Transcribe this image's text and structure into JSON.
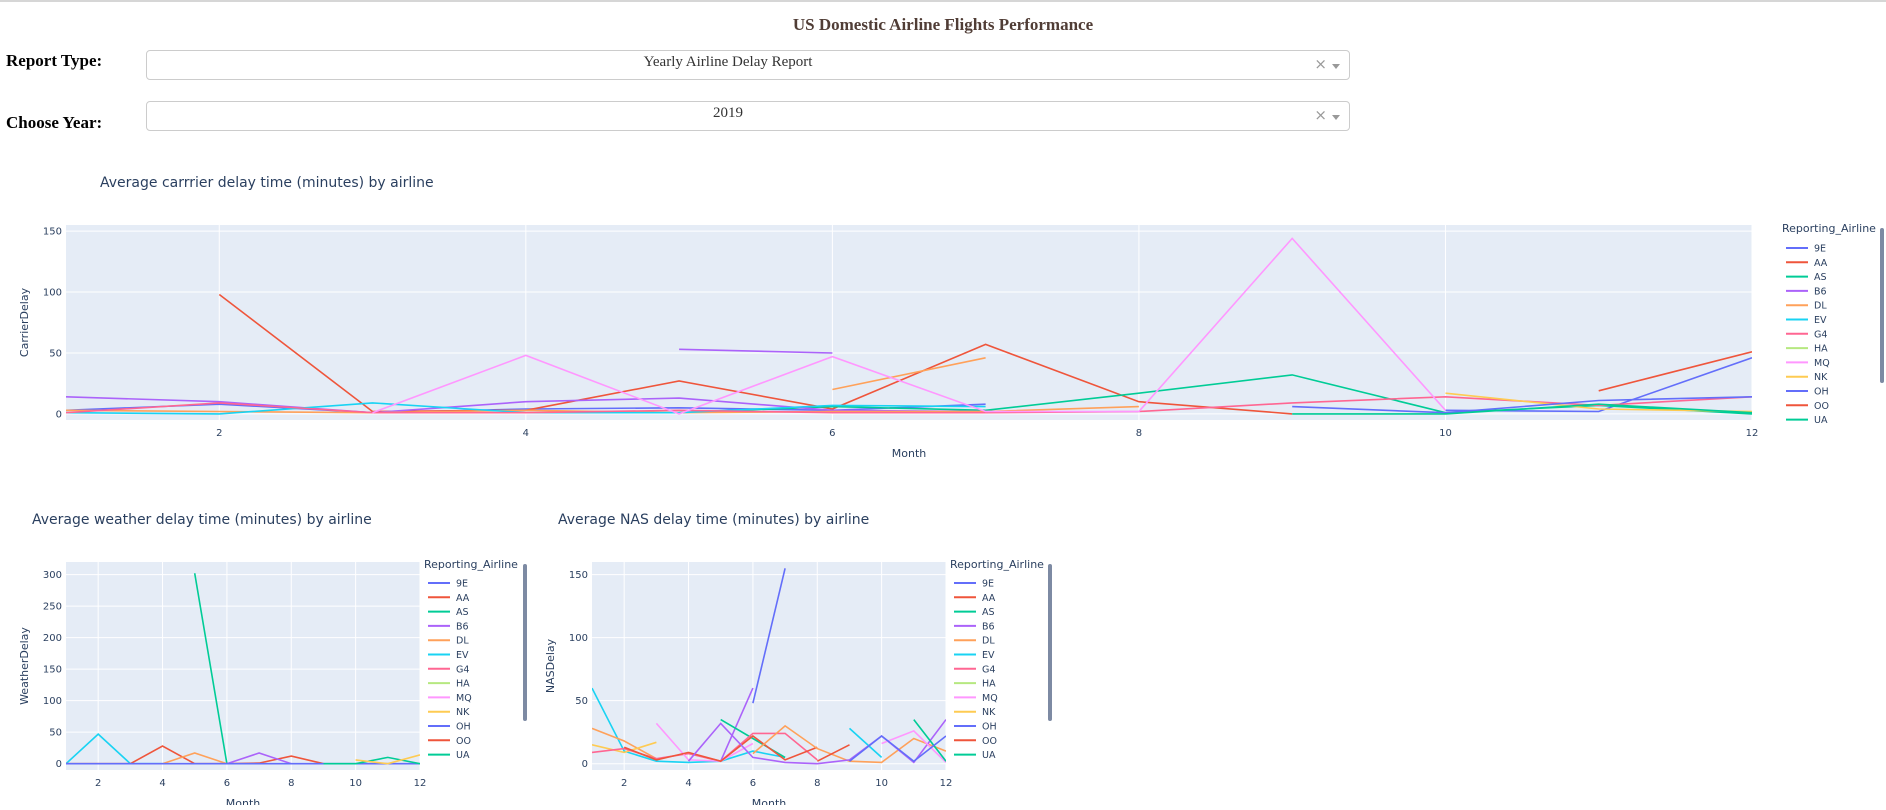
{
  "app_title": "US Domestic Airline Flights Performance",
  "controls": {
    "report_type_label": "Report Type:",
    "report_type_value": "Yearly Airline Delay Report",
    "year_label": "Choose Year:",
    "year_value": "2019",
    "clear_glyph": "×"
  },
  "legend_title": "Reporting_Airline",
  "airlines": [
    {
      "name": "9E",
      "color": "#636efa"
    },
    {
      "name": "AA",
      "color": "#EF553B"
    },
    {
      "name": "AS",
      "color": "#00cc96"
    },
    {
      "name": "B6",
      "color": "#ab63fa"
    },
    {
      "name": "DL",
      "color": "#FFA15A"
    },
    {
      "name": "EV",
      "color": "#19d3f3"
    },
    {
      "name": "G4",
      "color": "#FF6692"
    },
    {
      "name": "HA",
      "color": "#B6E880"
    },
    {
      "name": "MQ",
      "color": "#FF97FF"
    },
    {
      "name": "NK",
      "color": "#FECB52"
    },
    {
      "name": "OH",
      "color": "#636efa"
    },
    {
      "name": "OO",
      "color": "#EF553B"
    },
    {
      "name": "UA",
      "color": "#00cc96"
    }
  ],
  "chart_data": [
    {
      "id": "carrier",
      "type": "line",
      "title": "Average carrrier delay time (minutes) by airline",
      "xlabel": "Month",
      "ylabel": "CarrierDelay",
      "xlim": [
        1,
        12
      ],
      "ylim": [
        -5,
        155
      ],
      "xticks": [
        2,
        4,
        6,
        8,
        10,
        12
      ],
      "yticks": [
        0,
        50,
        100,
        150
      ],
      "grid": true,
      "legend": "right",
      "series": [
        {
          "name": "9E",
          "x": [
            1,
            2,
            3,
            4,
            5,
            6,
            7,
            8,
            9,
            10,
            11,
            12
          ],
          "y": [
            3,
            8,
            1,
            4,
            5,
            3,
            8,
            null,
            null,
            3,
            2,
            46
          ]
        },
        {
          "name": "AA",
          "x": [
            2,
            3,
            4,
            5,
            6,
            7,
            8,
            9
          ],
          "y": [
            98,
            2,
            3,
            27,
            4,
            57,
            10,
            0
          ]
        },
        {
          "name": "AS",
          "x": [
            5,
            6,
            7,
            8,
            9,
            10,
            11,
            12
          ],
          "y": [
            1,
            6,
            3,
            17,
            32,
            1,
            7,
            0
          ]
        },
        {
          "name": "B6",
          "x": [
            1,
            2,
            3,
            4,
            5,
            6,
            7
          ],
          "y": [
            14,
            10,
            1,
            10,
            13,
            3,
            2
          ]
        },
        {
          "name": "B6",
          "x": [
            5,
            6
          ],
          "y": [
            53,
            50
          ]
        },
        {
          "name": "DL",
          "x": [
            6,
            7
          ],
          "y": [
            20,
            46
          ]
        },
        {
          "name": "DL",
          "x": [
            1,
            2,
            3,
            4,
            5,
            6,
            7,
            8
          ],
          "y": [
            3,
            2,
            1,
            3,
            1,
            2,
            2,
            6
          ]
        },
        {
          "name": "EV",
          "x": [
            1,
            2,
            3,
            4,
            5,
            6,
            7
          ],
          "y": [
            1,
            0,
            9,
            1,
            1,
            7,
            6
          ]
        },
        {
          "name": "G4",
          "x": [
            1,
            2,
            3,
            4,
            5,
            6,
            7,
            8,
            9,
            10,
            11,
            12
          ],
          "y": [
            1,
            9,
            1,
            1,
            3,
            1,
            1,
            2,
            9,
            14,
            7,
            14
          ]
        },
        {
          "name": "MQ",
          "x": [
            3,
            4,
            5,
            6,
            7,
            8,
            9,
            10
          ],
          "y": [
            1,
            48,
            0,
            47,
            2,
            2,
            144,
            3
          ]
        },
        {
          "name": "NK",
          "x": [
            10,
            11,
            12
          ],
          "y": [
            17,
            4,
            2
          ]
        },
        {
          "name": "OH",
          "x": [
            9,
            10,
            11,
            12
          ],
          "y": [
            6,
            1,
            11,
            14
          ]
        },
        {
          "name": "OO",
          "x": [
            11,
            12
          ],
          "y": [
            19,
            51
          ]
        },
        {
          "name": "UA",
          "x": [
            9,
            10,
            11,
            12
          ],
          "y": [
            0,
            0,
            8,
            1
          ]
        }
      ]
    },
    {
      "id": "weather",
      "type": "line",
      "title": "Average weather delay time (minutes) by airline",
      "xlabel": "Month",
      "ylabel": "WeatherDelay",
      "xlim": [
        1,
        12
      ],
      "ylim": [
        -10,
        320
      ],
      "xticks": [
        2,
        4,
        6,
        8,
        10,
        12
      ],
      "yticks": [
        0,
        50,
        100,
        150,
        200,
        250,
        300
      ],
      "grid": true,
      "legend": "right",
      "series": [
        {
          "name": "AS",
          "x": [
            5,
            6
          ],
          "y": [
            302,
            0
          ]
        },
        {
          "name": "EV",
          "x": [
            1,
            2,
            3,
            4
          ],
          "y": [
            0,
            47,
            0,
            0
          ]
        },
        {
          "name": "AA",
          "x": [
            1,
            2,
            3,
            4,
            5,
            6,
            7,
            8,
            9
          ],
          "y": [
            0,
            0,
            0,
            28,
            0,
            0,
            1,
            12,
            0
          ]
        },
        {
          "name": "DL",
          "x": [
            4,
            5,
            6
          ],
          "y": [
            0,
            17,
            0
          ]
        },
        {
          "name": "B6",
          "x": [
            6,
            7,
            8
          ],
          "y": [
            0,
            17,
            0
          ]
        },
        {
          "name": "9E",
          "x": [
            1,
            2,
            3,
            4,
            5,
            6,
            7,
            8,
            9,
            10,
            11,
            12
          ],
          "y": [
            0,
            0,
            0,
            0,
            0,
            0,
            0,
            0,
            0,
            0,
            0,
            0
          ]
        },
        {
          "name": "UA",
          "x": [
            9,
            10,
            11,
            12
          ],
          "y": [
            0,
            0,
            10,
            0
          ]
        },
        {
          "name": "NK",
          "x": [
            10,
            11,
            12
          ],
          "y": [
            6,
            0,
            14
          ]
        }
      ]
    },
    {
      "id": "nas",
      "type": "line",
      "title": "Average NAS delay time (minutes) by airline",
      "xlabel": "Month",
      "ylabel": "NASDelay",
      "xlim": [
        1,
        12
      ],
      "ylim": [
        -5,
        160
      ],
      "xticks": [
        2,
        4,
        6,
        8,
        10,
        12
      ],
      "yticks": [
        0,
        50,
        100,
        150
      ],
      "grid": true,
      "legend": "right",
      "series": [
        {
          "name": "9E",
          "x": [
            6,
            7
          ],
          "y": [
            48,
            155
          ]
        },
        {
          "name": "B6",
          "x": [
            5,
            6
          ],
          "y": [
            2,
            60
          ]
        },
        {
          "name": "EV",
          "x": [
            1,
            2,
            3,
            4,
            5,
            6,
            7
          ],
          "y": [
            60,
            10,
            2,
            1,
            2,
            10,
            5
          ]
        },
        {
          "name": "DL",
          "x": [
            1,
            2,
            3
          ],
          "y": [
            28,
            18,
            4
          ]
        },
        {
          "name": "NK",
          "x": [
            1,
            2,
            3
          ],
          "y": [
            15,
            9,
            17
          ]
        },
        {
          "name": "AS",
          "x": [
            5,
            6,
            7
          ],
          "y": [
            35,
            20,
            5
          ]
        },
        {
          "name": "G4",
          "x": [
            1,
            2,
            3,
            4,
            5,
            6,
            7,
            8
          ],
          "y": [
            9,
            12,
            4,
            8,
            2,
            24,
            24,
            3
          ]
        },
        {
          "name": "MQ",
          "x": [
            3,
            4,
            5,
            6
          ],
          "y": [
            32,
            3,
            2,
            16
          ]
        },
        {
          "name": "AA",
          "x": [
            2,
            3,
            4,
            5,
            6,
            7,
            8
          ],
          "y": [
            13,
            3,
            9,
            2,
            22,
            3,
            13
          ]
        },
        {
          "name": "DL",
          "x": [
            6,
            7,
            8,
            9,
            10,
            11,
            12
          ],
          "y": [
            8,
            30,
            12,
            2,
            1,
            20,
            10
          ]
        },
        {
          "name": "B6",
          "x": [
            4,
            5,
            6,
            7,
            8,
            9,
            10,
            11,
            12
          ],
          "y": [
            2,
            32,
            5,
            1,
            0,
            3,
            22,
            1,
            35
          ]
        },
        {
          "name": "EV",
          "x": [
            9,
            10
          ],
          "y": [
            28,
            5
          ]
        },
        {
          "name": "MQ",
          "x": [
            10,
            11,
            12
          ],
          "y": [
            16,
            26,
            1
          ]
        },
        {
          "name": "AS",
          "x": [
            11,
            12
          ],
          "y": [
            35,
            2
          ]
        },
        {
          "name": "OO",
          "x": [
            8,
            9
          ],
          "y": [
            2,
            15
          ]
        },
        {
          "name": "OH",
          "x": [
            9,
            10,
            11,
            12
          ],
          "y": [
            2,
            22,
            2,
            22
          ]
        }
      ]
    }
  ]
}
